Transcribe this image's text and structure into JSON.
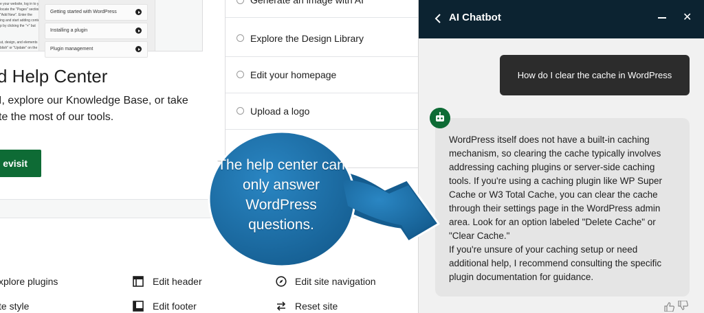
{
  "left": {
    "preview": {
      "text_lines": [
        "e your website, log in to your",
        "locate the \"Pages\" section",
        "\"Add New\". Enter the",
        "ing and start adding conte",
        "p by clicking the \"+\" but",
        "",
        "",
        "ut, design, and elements",
        "blish\" or \"Update\" on the"
      ],
      "items": [
        "Getting started with WordPress",
        "Installing a plugin",
        "Plugin management"
      ]
    },
    "help_center_title": "d Help Center",
    "help_center_desc": "I, explore our Knowledge Base, or take te the most of our tools.",
    "revisit_label": "evisit",
    "tasks": [
      "Generate an image with AI",
      "Explore the Design Library",
      "Edit your homepage",
      "Upload a logo"
    ],
    "tools": [
      {
        "label": "xplore plugins",
        "icon": "none"
      },
      {
        "label": "Edit header",
        "icon": "layout-header-icon"
      },
      {
        "label": "Edit site navigation",
        "icon": "compass-icon"
      },
      {
        "label": "te style",
        "icon": "none"
      },
      {
        "label": "Edit footer",
        "icon": "layout-footer-icon"
      },
      {
        "label": "Reset site",
        "icon": "reset-arrows-icon"
      }
    ]
  },
  "chat": {
    "title": "AI Chatbot",
    "user_message": "How do I clear the cache in WordPress",
    "bot_paragraphs": [
      "WordPress itself does not have a built-in caching mechanism, so clearing the cache typically involves addressing caching plugins or server-side caching tools. If you're using a caching plugin like WP Super Cache or W3 Total Cache, you can clear the cache through their settings page in the WordPress admin area. Look for an option labeled \"Delete Cache\" or \"Clear Cache.\"",
      "If you're unsure of your caching setup or need additional help, I recommend consulting the specific plugin documentation for guidance."
    ],
    "colors": {
      "header": "#0c2331",
      "avatar": "#0e6b35",
      "user_bubble": "#2c2c2c",
      "bot_bubble": "#e5e5e5"
    }
  },
  "callout": {
    "text": "The help center can only answer WordPress questions.",
    "color": "#1a6fa8"
  }
}
